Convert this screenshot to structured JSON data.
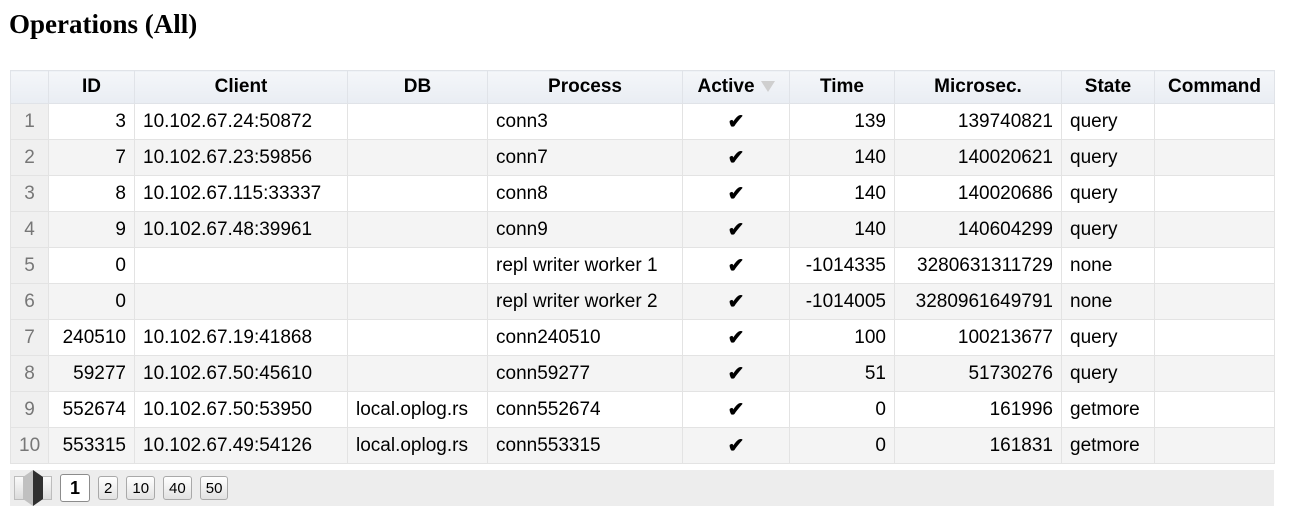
{
  "page": {
    "title": "Operations (All)"
  },
  "table": {
    "columns": [
      "",
      "ID",
      "Client",
      "DB",
      "Process",
      "Active",
      "Time",
      "Microsec.",
      "State",
      "Command"
    ],
    "sorted_column": "Active",
    "rows": [
      {
        "n": "1",
        "id": "3",
        "client": "10.102.67.24:50872",
        "db": "",
        "process": "conn3",
        "active": "✔",
        "time": "139",
        "microsec": "139740821",
        "state": "query",
        "command": ""
      },
      {
        "n": "2",
        "id": "7",
        "client": "10.102.67.23:59856",
        "db": "",
        "process": "conn7",
        "active": "✔",
        "time": "140",
        "microsec": "140020621",
        "state": "query",
        "command": ""
      },
      {
        "n": "3",
        "id": "8",
        "client": "10.102.67.115:33337",
        "db": "",
        "process": "conn8",
        "active": "✔",
        "time": "140",
        "microsec": "140020686",
        "state": "query",
        "command": ""
      },
      {
        "n": "4",
        "id": "9",
        "client": "10.102.67.48:39961",
        "db": "",
        "process": "conn9",
        "active": "✔",
        "time": "140",
        "microsec": "140604299",
        "state": "query",
        "command": ""
      },
      {
        "n": "5",
        "id": "0",
        "client": "",
        "db": "",
        "process": "repl writer worker 1",
        "active": "✔",
        "time": "-1014335",
        "microsec": "3280631311729",
        "state": "none",
        "command": ""
      },
      {
        "n": "6",
        "id": "0",
        "client": "",
        "db": "",
        "process": "repl writer worker 2",
        "active": "✔",
        "time": "-1014005",
        "microsec": "3280961649791",
        "state": "none",
        "command": ""
      },
      {
        "n": "7",
        "id": "240510",
        "client": "10.102.67.19:41868",
        "db": "",
        "process": "conn240510",
        "active": "✔",
        "time": "100",
        "microsec": "100213677",
        "state": "query",
        "command": ""
      },
      {
        "n": "8",
        "id": "59277",
        "client": "10.102.67.50:45610",
        "db": "",
        "process": "conn59277",
        "active": "✔",
        "time": "51",
        "microsec": "51730276",
        "state": "query",
        "command": ""
      },
      {
        "n": "9",
        "id": "552674",
        "client": "10.102.67.50:53950",
        "db": "local.oplog.rs",
        "process": "conn552674",
        "active": "✔",
        "time": "0",
        "microsec": "161996",
        "state": "getmore",
        "command": ""
      },
      {
        "n": "10",
        "id": "553315",
        "client": "10.102.67.49:54126",
        "db": "local.oplog.rs",
        "process": "conn553315",
        "active": "✔",
        "time": "0",
        "microsec": "161831",
        "state": "getmore",
        "command": ""
      }
    ]
  },
  "pager": {
    "page_sizes": [
      "1",
      "2",
      "10",
      "40",
      "50"
    ],
    "selected": "1",
    "icons": {
      "prev": "prev-page-icon",
      "next": "next-page-icon",
      "sort": "sort-desc-icon"
    }
  }
}
